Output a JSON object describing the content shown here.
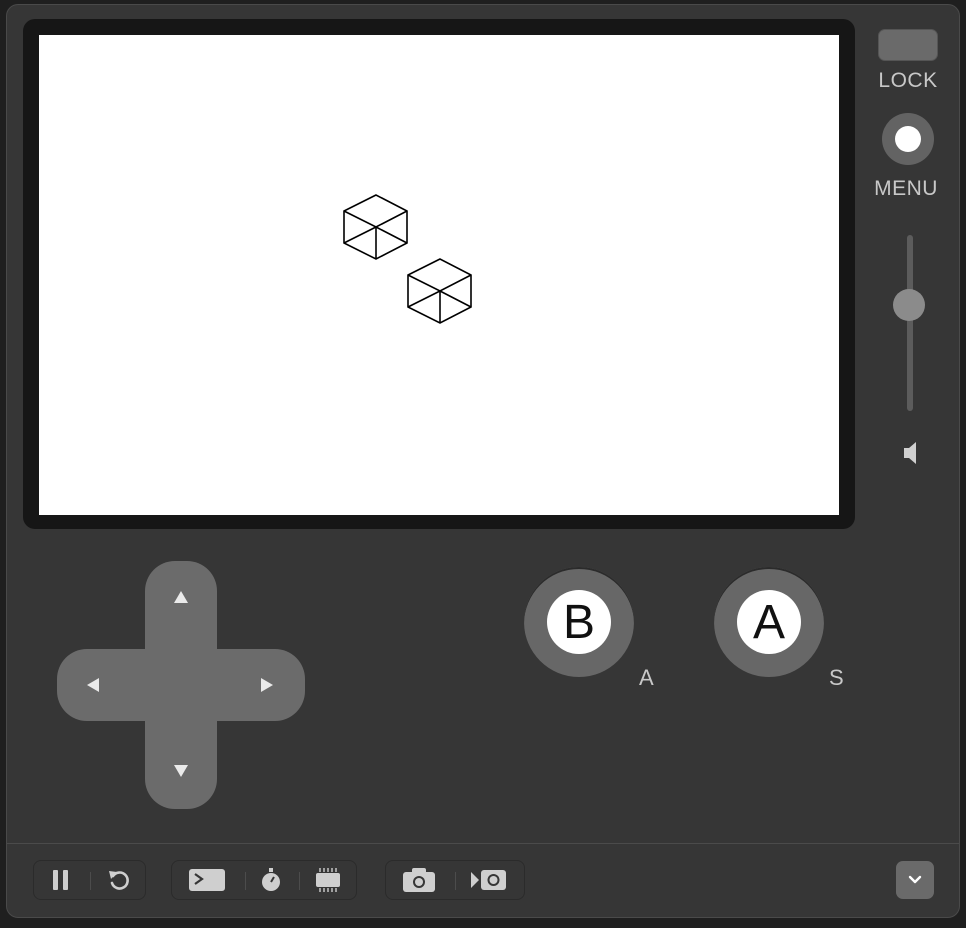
{
  "side_panel": {
    "lock_label": "LOCK",
    "menu_label": "MENU",
    "volume_level": 0.6
  },
  "buttons": {
    "b_label": "B",
    "b_key": "A",
    "a_label": "A",
    "a_key": "S"
  },
  "dpad": {
    "up": "up-arrow-icon",
    "down": "down-arrow-icon",
    "left": "left-arrow-icon",
    "right": "right-arrow-icon"
  },
  "toolbar": {
    "icons": [
      "pause-icon",
      "restart-icon",
      "console-icon",
      "stopwatch-icon",
      "cpu-icon",
      "camera-icon",
      "record-video-icon",
      "chevron-down-icon"
    ]
  },
  "colors": {
    "body": "#363636",
    "button": "#676767",
    "screen": "#ffffff"
  }
}
